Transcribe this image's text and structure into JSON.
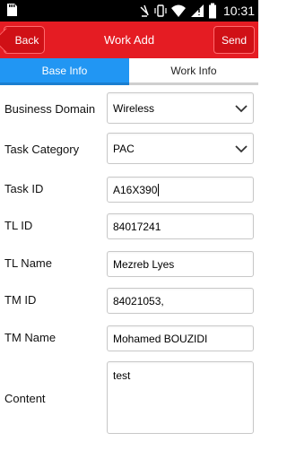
{
  "status": {
    "time": "10:31"
  },
  "appbar": {
    "back_label": "Back",
    "title": "Work Add",
    "send_label": "Send"
  },
  "tabs": [
    {
      "label": "Base Info"
    },
    {
      "label": "Work Info"
    }
  ],
  "form": {
    "business_domain": {
      "label": "Business Domain",
      "value": "Wireless"
    },
    "task_category": {
      "label": "Task Category",
      "value": "PAC"
    },
    "task_id": {
      "label": "Task ID",
      "value": "A16X390"
    },
    "tl_id": {
      "label": "TL ID",
      "value": "84017241"
    },
    "tl_name": {
      "label": "TL Name",
      "value": "Mezreb Lyes"
    },
    "tm_id": {
      "label": "TM ID",
      "value": "84021053,"
    },
    "tm_name": {
      "label": "TM Name",
      "value": "Mohamed BOUZIDI"
    },
    "content": {
      "label": "Content",
      "value": "test"
    }
  },
  "colors": {
    "primary": "#e51c23",
    "tab_active": "#2196f3"
  }
}
